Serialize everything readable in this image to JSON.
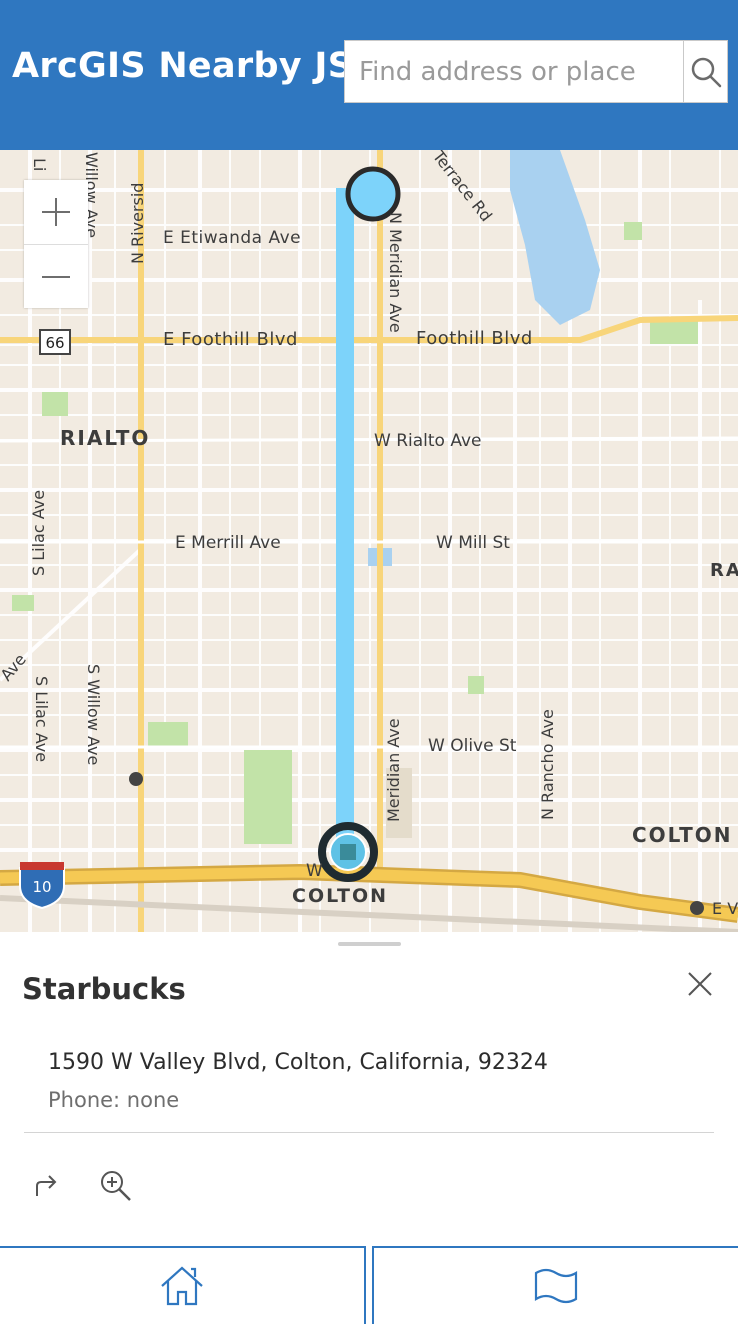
{
  "header": {
    "title": "ArcGIS Nearby JS",
    "search_placeholder": "Find address or place",
    "search_value": "",
    "background_color": "#2f77c0"
  },
  "map": {
    "zoom_in_icon": "plus-icon",
    "zoom_out_icon": "minus-icon",
    "route_color": "#7dd3fa",
    "labels": {
      "e_etiwanda": "E Etiwanda Ave",
      "n_riverside": "N Riversid",
      "willow_top": "Willow Ave",
      "lilac_top": "Li",
      "terrace": "Terrace Rd",
      "n_meridian": "N Meridian Ave",
      "route_66": "66",
      "e_foothill": "E Foothill Blvd",
      "foothill": "Foothill Blvd",
      "rialto": "RIALTO",
      "w_rialto": "W Rialto Ave",
      "s_lilac_1": "S Lilac Ave",
      "e_merrill": "E Merrill Ave",
      "w_mill": "W Mill St",
      "ra_right": "RA",
      "ave_left": "Ave",
      "s_lilac_2": "S Lilac Ave",
      "s_willow": "S Willow Ave",
      "meridian": "Meridian Ave",
      "w_olive": "W Olive St",
      "n_rancho": "N Rancho Ave",
      "colton_right": "COLTON",
      "i10": "10",
      "colton": "COLTON",
      "w_label": "W",
      "va_label": "E Va"
    }
  },
  "panel": {
    "name": "Starbucks",
    "address": "1590 W Valley Blvd, Colton, California, 92324",
    "phone": "Phone: none",
    "close_icon": "close-icon",
    "directions_icon": "directions-arrow-icon",
    "zoom_to_icon": "zoom-to-icon"
  },
  "bottom_nav": {
    "home_icon": "home-icon",
    "map_icon": "map-icon",
    "accent_color": "#2f77c0"
  }
}
